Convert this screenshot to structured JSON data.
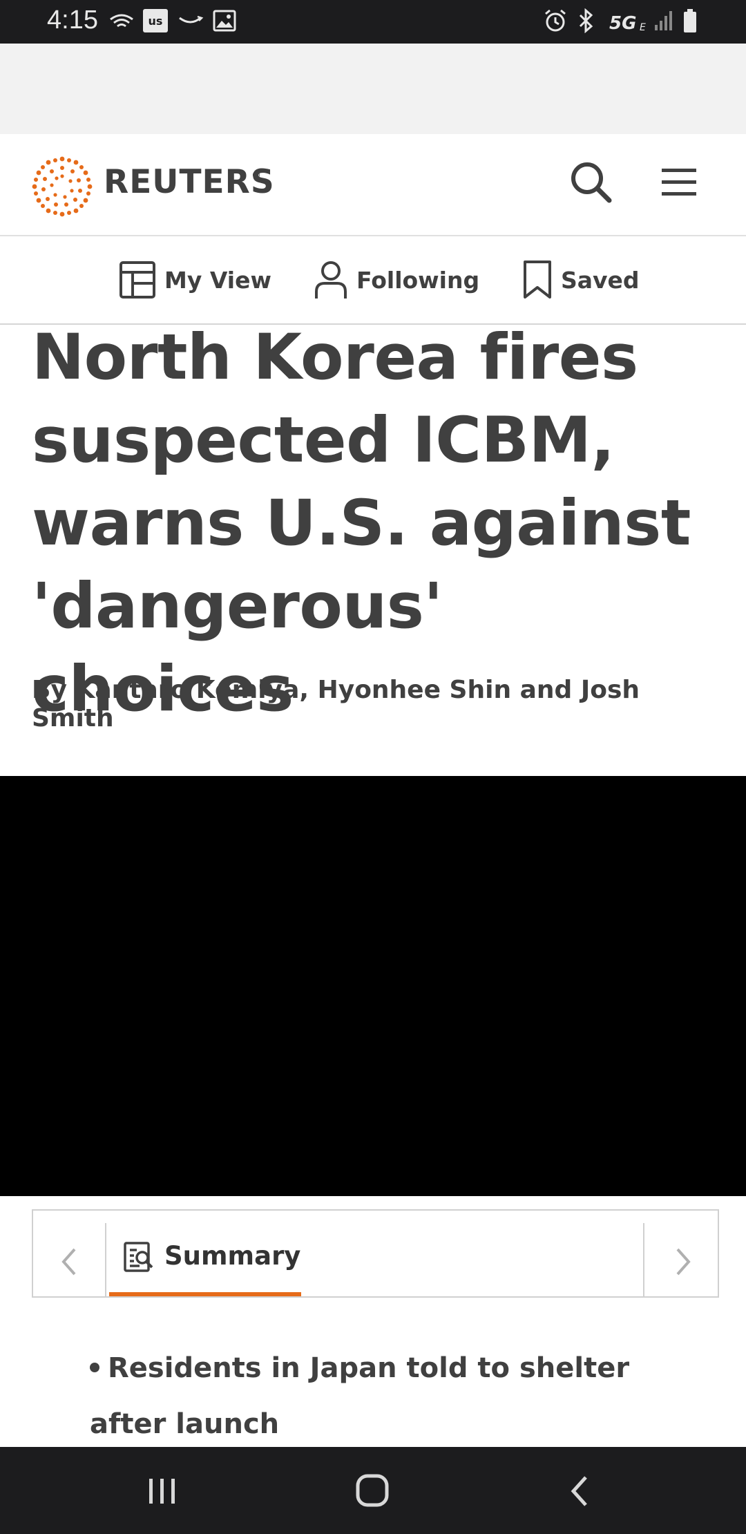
{
  "status_bar": {
    "time": "4:15",
    "network_label": "5G",
    "left_icons": [
      "wifi-calling-icon",
      "us-app-icon",
      "amazon-icon",
      "image-icon"
    ],
    "right_icons": [
      "alarm-icon",
      "bluetooth-icon",
      "5g-icon",
      "signal-icon",
      "battery-icon"
    ]
  },
  "header": {
    "logo_text": "REUTERS",
    "logo_reg": "®",
    "accent_color": "#e66b19"
  },
  "sub_nav": {
    "items": [
      {
        "label": "My View",
        "icon": "my-view-icon"
      },
      {
        "label": "Following",
        "icon": "person-icon"
      },
      {
        "label": "Saved",
        "icon": "bookmark-icon"
      }
    ]
  },
  "article": {
    "headline": "North Korea fires suspected ICBM, warns U.S. against 'dangerous' choices",
    "byline": "By Kantaro Komiya, Hyonhee Shin and Josh Smith"
  },
  "tabs": {
    "active_label": "Summary"
  },
  "summary": {
    "bullets": [
      "Residents in Japan told to shelter after launch"
    ]
  }
}
